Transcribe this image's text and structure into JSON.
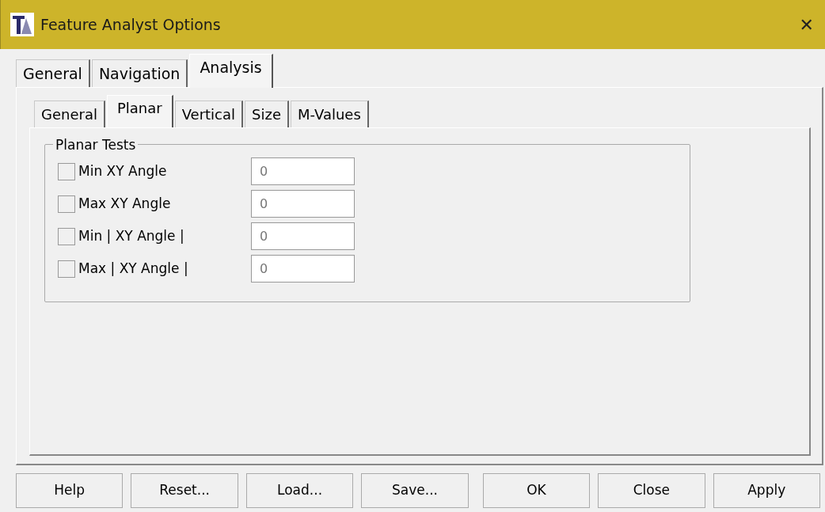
{
  "window": {
    "title": "Feature Analyst Options",
    "close": "✕"
  },
  "tabs": [
    {
      "label": "General",
      "selected": false
    },
    {
      "label": "Navigation",
      "selected": false
    },
    {
      "label": "Analysis",
      "selected": true
    }
  ],
  "subtabs": [
    {
      "label": "General",
      "selected": false
    },
    {
      "label": "Planar",
      "selected": true
    },
    {
      "label": "Vertical",
      "selected": false
    },
    {
      "label": "Size",
      "selected": false
    },
    {
      "label": "M-Values",
      "selected": false
    }
  ],
  "group": {
    "title": "Planar Tests",
    "rows": [
      {
        "label": "Min XY Angle",
        "checked": false,
        "value": "0"
      },
      {
        "label": "Max XY Angle",
        "checked": false,
        "value": "0"
      },
      {
        "label": "Min | XY Angle |",
        "checked": false,
        "value": "0"
      },
      {
        "label": "Max | XY Angle |",
        "checked": false,
        "value": "0"
      }
    ]
  },
  "buttons": [
    "Help",
    "Reset...",
    "Load...",
    "Save...",
    "OK",
    "Close",
    "Apply"
  ]
}
